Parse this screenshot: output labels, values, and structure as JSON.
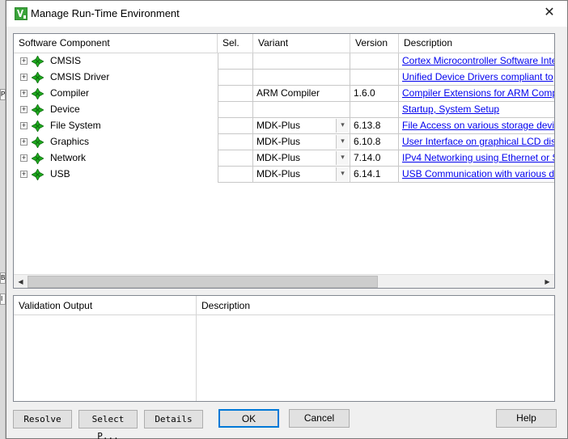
{
  "window": {
    "title": "Manage Run-Time Environment",
    "close_glyph": "✕"
  },
  "background_tabs": [
    "P",
    "B",
    "I"
  ],
  "grid": {
    "headers": [
      "Software Component",
      "Sel.",
      "Variant",
      "Version",
      "Description"
    ],
    "rows": [
      {
        "name": "CMSIS",
        "variant": "",
        "version": "",
        "description": "Cortex Microcontroller Software Inte",
        "has_dropdown": false
      },
      {
        "name": "CMSIS Driver",
        "variant": "",
        "version": "",
        "description": "Unified Device Drivers compliant to",
        "has_dropdown": false
      },
      {
        "name": "Compiler",
        "variant": "ARM Compiler",
        "version": "1.6.0",
        "description": "Compiler Extensions for ARM Comp",
        "has_dropdown": false
      },
      {
        "name": "Device",
        "variant": "",
        "version": "",
        "description": "Startup, System Setup",
        "has_dropdown": false
      },
      {
        "name": "File System",
        "variant": "MDK-Plus",
        "version": "6.13.8",
        "description": "File Access on various storage devic",
        "has_dropdown": true
      },
      {
        "name": "Graphics",
        "variant": "MDK-Plus",
        "version": "6.10.8",
        "description": "User Interface on graphical LCD disp",
        "has_dropdown": true
      },
      {
        "name": "Network",
        "variant": "MDK-Plus",
        "version": "7.14.0",
        "description": "IPv4 Networking using Ethernet or S",
        "has_dropdown": true
      },
      {
        "name": "USB",
        "variant": "MDK-Plus",
        "version": "6.14.1",
        "description": "USB Communication with various d",
        "has_dropdown": true
      }
    ]
  },
  "validation": {
    "headers": [
      "Validation Output",
      "Description"
    ]
  },
  "buttons": {
    "resolve": "Resolve",
    "select_packs": "Select P...",
    "details": "Details",
    "ok": "OK",
    "cancel": "Cancel",
    "help": "Help"
  },
  "colors": {
    "link": "#0000ee",
    "gem": "#1ea81e"
  }
}
